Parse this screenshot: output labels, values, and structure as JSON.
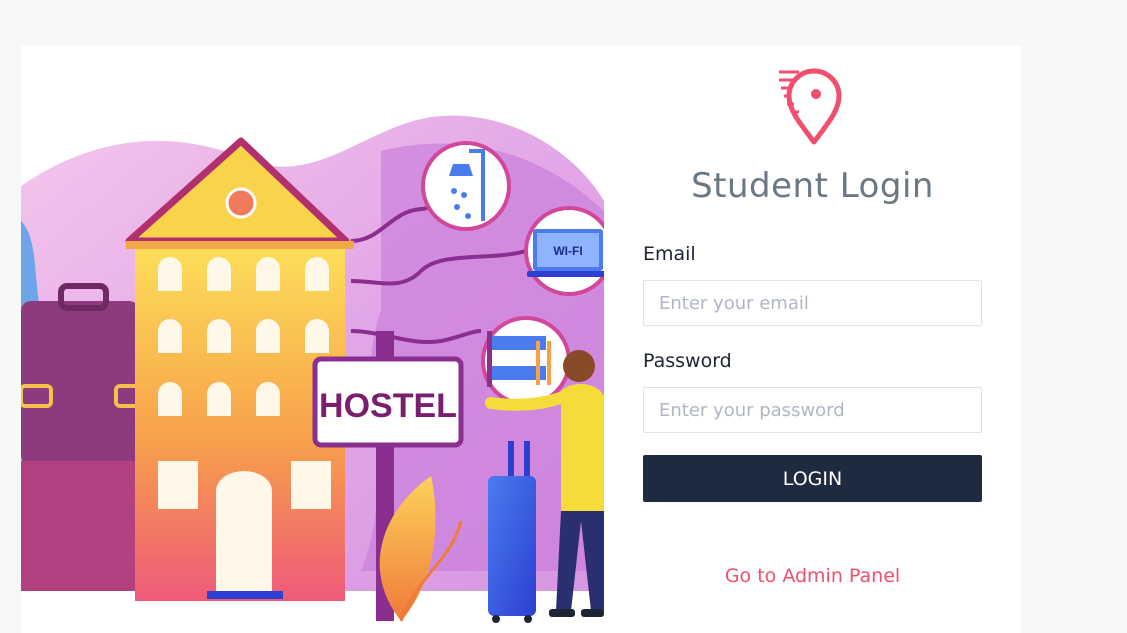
{
  "illustration": {
    "sign_text": "HOSTEL",
    "wifi_text": "WI-FI"
  },
  "form": {
    "title": "Student Login",
    "email_label": "Email",
    "email_placeholder": "Enter your email",
    "email_value": "",
    "password_label": "Password",
    "password_placeholder": "Enter your password",
    "password_value": "",
    "login_label": "LOGIN",
    "admin_link": "Go to Admin Panel"
  },
  "colors": {
    "accent": "#f0506e",
    "button": "#1d2a3f",
    "title": "#6b7785"
  }
}
